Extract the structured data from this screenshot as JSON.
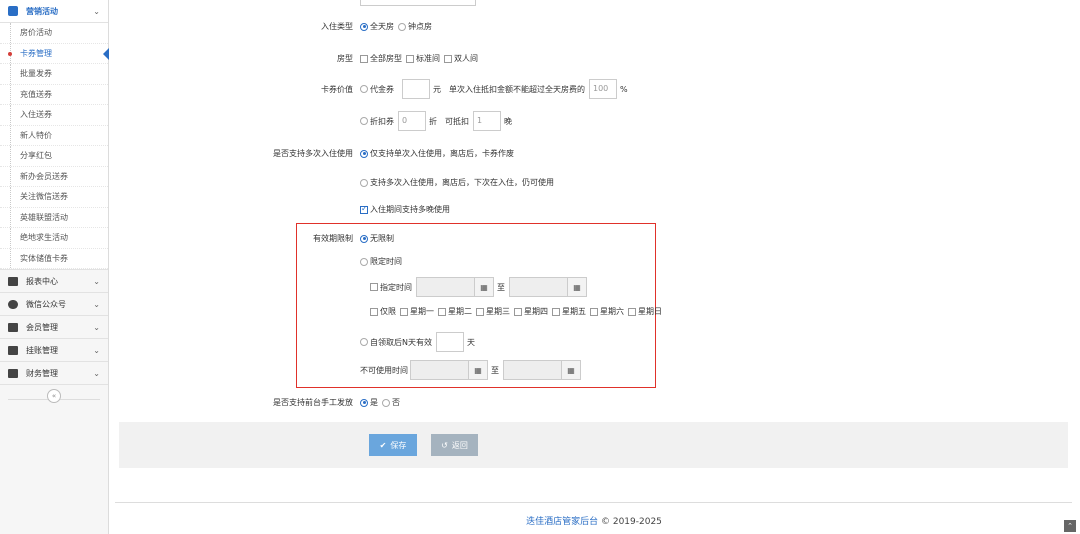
{
  "sidebar": {
    "header": "营销活动",
    "sub_items": [
      "房价活动",
      "卡券管理",
      "批量发券",
      "充值送券",
      "入住送券",
      "新人特价",
      "分享红包",
      "新办会员送券",
      "关注微信送券",
      "英雄联盟活动",
      "绝地求生活动",
      "实体储值卡券"
    ],
    "active_index": 1,
    "menus": [
      "报表中心",
      "微信公众号",
      "会员管理",
      "挂账管理",
      "财务管理"
    ],
    "collapse_glyph": "«"
  },
  "form": {
    "checkin_type": {
      "label": "入住类型",
      "options": [
        "全天房",
        "钟点房"
      ],
      "selected": 0
    },
    "room_type": {
      "label": "房型",
      "options": [
        "全部房型",
        "标准间",
        "双人间"
      ]
    },
    "coupon_value": {
      "label": "卡券价值",
      "cash": {
        "name": "代金券",
        "unit": "元",
        "note": "单次入住抵扣金额不能超过全天房费的",
        "percent": "100",
        "percent_unit": "%"
      },
      "discount": {
        "name": "折扣券",
        "value": "0",
        "unit": "折",
        "deduct_label": "可抵扣",
        "nights": "1",
        "nights_unit": "晚"
      }
    },
    "multi_use": {
      "label": "是否支持多次入住使用",
      "option1": "仅支持单次入住使用，离店后，卡券作废",
      "option2": "支持多次入住使用，离店后，下次在入住，仍可使用",
      "checkbox": "入住期间支持多晚使用"
    },
    "validity": {
      "label": "有效期限制",
      "unlimited": "无限制",
      "limited": "限定时间",
      "specified": "指定时间",
      "to": "至",
      "only": "仅限",
      "weekdays": [
        "星期一",
        "星期二",
        "星期三",
        "星期四",
        "星期五",
        "星期六",
        "星期日"
      ],
      "after_claim": "自领取后N天有效",
      "day_unit": "天",
      "unavailable": "不可使用时间"
    },
    "manual_issue": {
      "label": "是否支持前台手工发放",
      "yes": "是",
      "no": "否"
    }
  },
  "buttons": {
    "save": "保存",
    "back": "返回"
  },
  "footer": {
    "brand": "迭佳酒店管家后台",
    "copyright": "© 2019-2025"
  },
  "colors": {
    "accent": "#2a6ec5",
    "highlight_box": "#e0312a",
    "save_btn": "#6aa6dd",
    "back_btn": "#a5b3bf"
  }
}
